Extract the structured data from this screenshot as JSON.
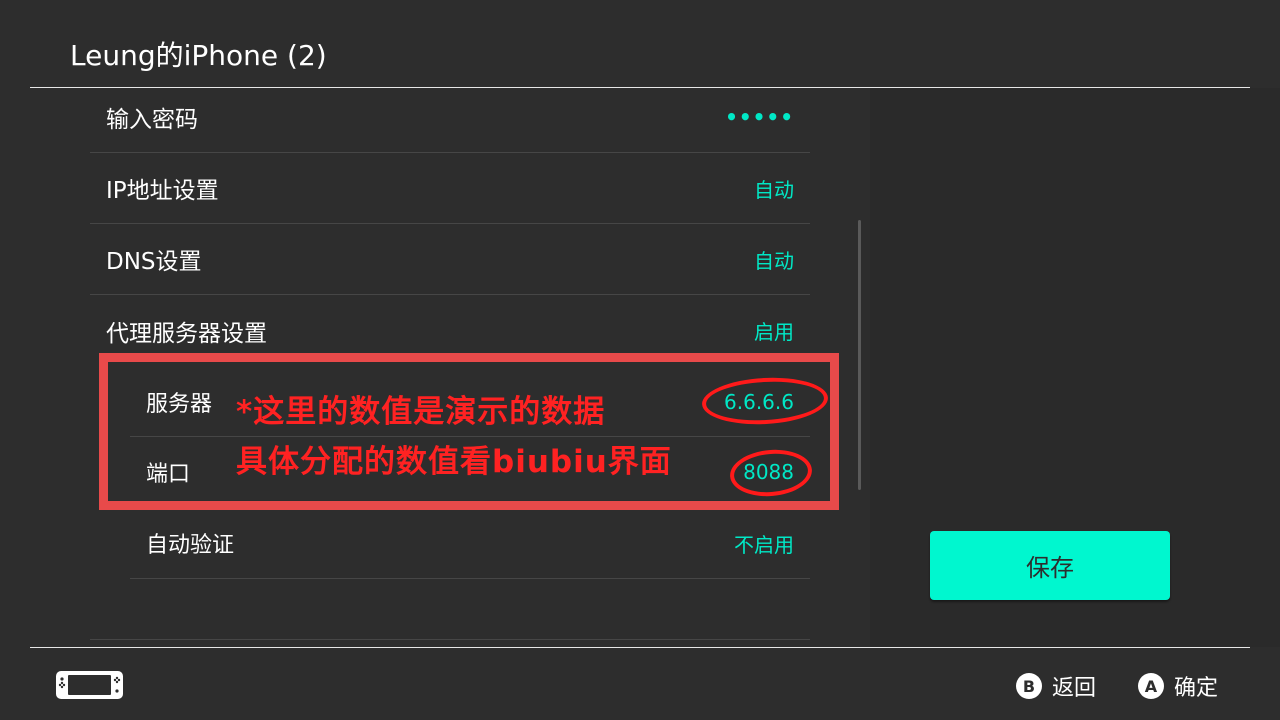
{
  "header": {
    "title": "Leung的iPhone (2)"
  },
  "settings": {
    "password": {
      "label": "输入密码",
      "value": "•••••"
    },
    "ip": {
      "label": "IP地址设置",
      "value": "自动"
    },
    "dns": {
      "label": "DNS设置",
      "value": "自动"
    },
    "proxy": {
      "label": "代理服务器设置",
      "value": "启用"
    },
    "server": {
      "label": "服务器",
      "value": "6.6.6.6"
    },
    "port": {
      "label": "端口",
      "value": "8088"
    },
    "auto_auth": {
      "label": "自动验证",
      "value": "不启用"
    }
  },
  "annotation": {
    "line1": "*这里的数值是演示的数据",
    "line2": "具体分配的数值看biubiu界面"
  },
  "save_button": {
    "label": "保存"
  },
  "footer": {
    "back": {
      "key": "B",
      "label": "返回"
    },
    "confirm": {
      "key": "A",
      "label": "确定"
    }
  },
  "colors": {
    "background": "#2d2d2d",
    "accent": "#00e8c6",
    "button": "#00f7cf",
    "annotation": "#ff2222"
  }
}
